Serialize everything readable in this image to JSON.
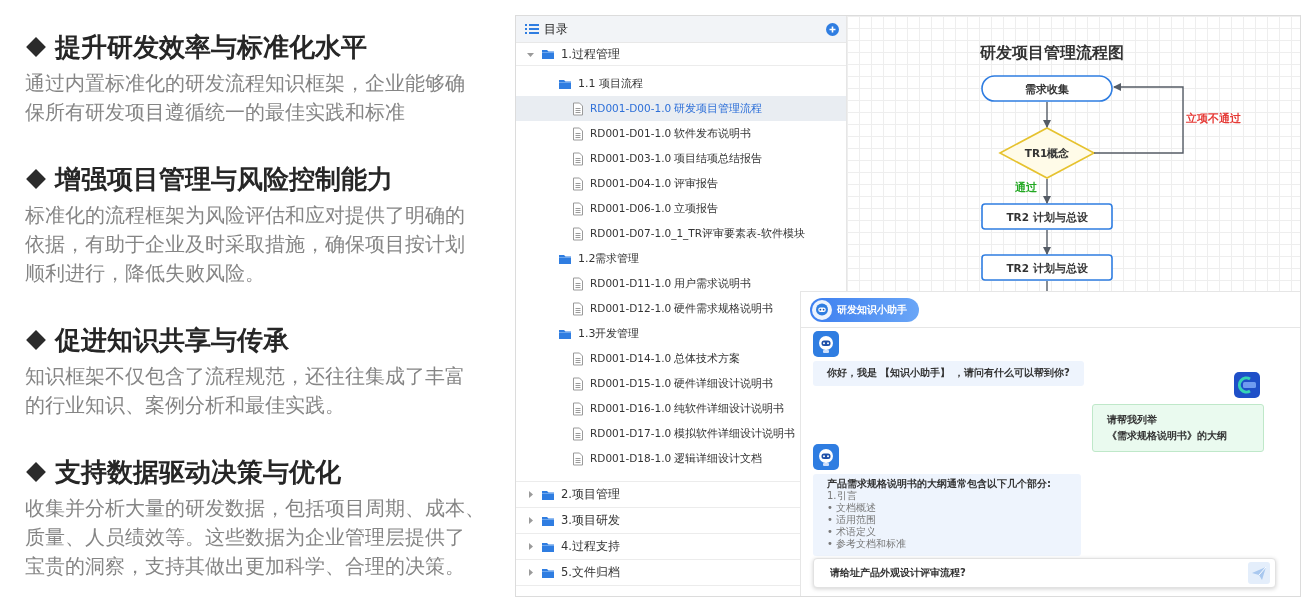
{
  "sections": [
    {
      "heading": "提升研发效率与标准化水平",
      "lines": [
        "通过内置标准化的研发流程知识框架，企业能够确",
        "保所有研发项目遵循统一的最佳实践和标准"
      ]
    },
    {
      "heading": "增强项目管理与风险控制能力",
      "lines": [
        "标准化的流程框架为风险评估和应对提供了明确的",
        "依据，有助于企业及时采取措施，确保项目按计划",
        "顺利进行，降低失败风险。"
      ]
    },
    {
      "heading": "促进知识共享与传承",
      "lines": [
        "知识框架不仅包含了流程规范，还往往集成了丰富",
        "的行业知识、案例分析和最佳实践。"
      ]
    },
    {
      "heading": "支持数据驱动决策与优化",
      "lines": [
        "收集并分析大量的研发数据，包括项目周期、成本、",
        "质量、人员绩效等。这些数据为企业管理层提供了",
        "宝贵的洞察，支持其做出更加科学、合理的决策。"
      ]
    }
  ],
  "outline": {
    "title": "目录",
    "items": [
      {
        "label": "1.过程管理",
        "expanded": true,
        "children": [
          {
            "label": "1.1 项目流程",
            "children": [
              {
                "label": "RD001-D00-1.0 研发项目管理流程",
                "selected": true
              },
              {
                "label": "RD001-D01-1.0 软件发布说明书",
                "selected": false
              },
              {
                "label": "RD001-D03-1.0 项目结项总结报告",
                "selected": false
              },
              {
                "label": "RD001-D04-1.0 评审报告",
                "selected": false
              },
              {
                "label": "RD001-D06-1.0 立项报告",
                "selected": false
              },
              {
                "label": "RD001-D07-1.0_1_TR评审要素表-软件模块",
                "selected": false
              }
            ]
          },
          {
            "label": "1.2需求管理",
            "children": [
              {
                "label": "RD001-D11-1.0 用户需求说明书",
                "selected": false
              },
              {
                "label": "RD001-D12-1.0 硬件需求规格说明书",
                "selected": false
              }
            ]
          },
          {
            "label": "1.3开发管理",
            "children": [
              {
                "label": "RD001-D14-1.0 总体技术方案",
                "selected": false
              },
              {
                "label": "RD001-D15-1.0 硬件详细设计说明书",
                "selected": false
              },
              {
                "label": "RD001-D16-1.0 纯软件详细设计说明书",
                "selected": false
              },
              {
                "label": "RD001-D17-1.0 模拟软件详细设计说明书",
                "selected": false
              },
              {
                "label": "RD001-D18-1.0 逻辑详细设计文档",
                "selected": false
              }
            ]
          }
        ]
      },
      {
        "label": "2.项目管理",
        "expanded": false
      },
      {
        "label": "3.项目研发",
        "expanded": false
      },
      {
        "label": "4.过程支持",
        "expanded": false
      },
      {
        "label": "5.文件归档",
        "expanded": false
      }
    ]
  },
  "flowchart": {
    "title": "研发项目管理流程图",
    "nodes": [
      {
        "kind": "terminal",
        "label": "需求收集"
      },
      {
        "kind": "decision",
        "label": "TR1概念"
      },
      {
        "kind": "process",
        "label": "TR2 计划与总设"
      },
      {
        "kind": "process",
        "label": "TR2 计划与总设"
      }
    ],
    "edge_labels": [
      {
        "kind": "reject",
        "label": "立项不通过",
        "color": "#e53935"
      },
      {
        "kind": "pass",
        "label": "通过",
        "color": "#22a822"
      }
    ]
  },
  "chat": {
    "title": "研发知识小助手",
    "messages": [
      {
        "kind": "bot",
        "lines": [
          "你好，我是 【知识小助手】 ，请问有什么可以帮到你?"
        ]
      },
      {
        "kind": "user",
        "lines": [
          "请帮我列举",
          "《需求规格说明书》的大纲"
        ]
      },
      {
        "kind": "bot",
        "heading": "产品需求规格说明书的大纲通常包含以下几个部分:",
        "lines": [
          "1.引言",
          "• 文档概述",
          "• 适用范围",
          "• 术语定义",
          "• 参考文档和标准"
        ]
      }
    ],
    "input": {
      "value": "请给址产品外观设计评审流程?"
    }
  }
}
